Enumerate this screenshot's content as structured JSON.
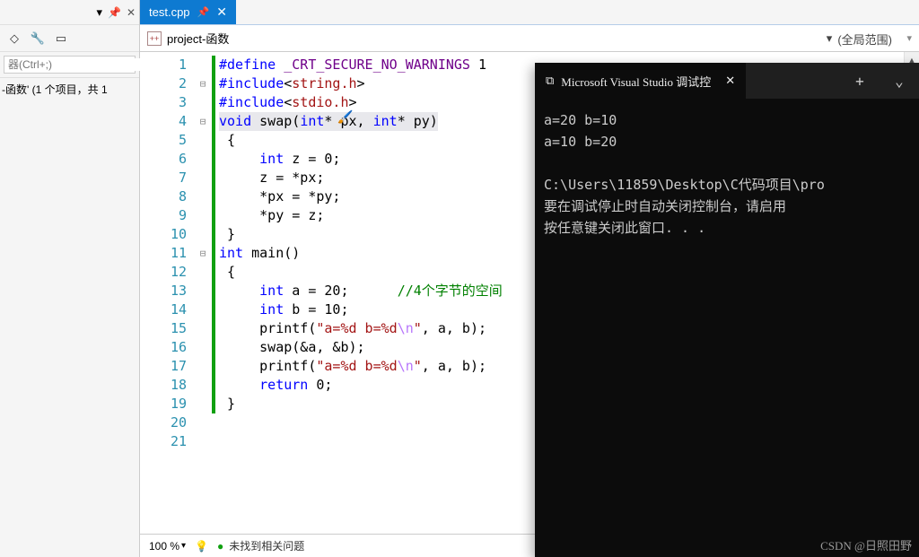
{
  "leftPanel": {
    "searchPlaceholder": "器(Ctrl+;)",
    "treeItem": "-函数' (1 个项目，共 1"
  },
  "tab": {
    "name": "test.cpp"
  },
  "breadcrumb": {
    "text": "project-函数"
  },
  "scope": {
    "text": "(全局范围)"
  },
  "code": {
    "lines": [
      {
        "n": 1,
        "fold": "",
        "html": "<span class='kw'>#define</span> <span class='macro'>_CRT_SECURE_NO_WARNINGS</span> 1"
      },
      {
        "n": 2,
        "fold": "⊟",
        "html": "<span class='kw'>#include</span>&lt;<span class='str'>string.h</span>&gt;"
      },
      {
        "n": 3,
        "fold": "",
        "html": "<span class='kw'>#include</span>&lt;<span class='str'>stdio.h</span>&gt;"
      },
      {
        "n": 4,
        "fold": "⊟",
        "html": "<span class='hl-line'><span class='kw'>void</span> swap(<span class='kw-int'>int</span><span class='star'>*</span> px, <span class='kw-int'>int</span><span class='star'>*</span> py)</span>"
      },
      {
        "n": 5,
        "fold": "",
        "html": " {"
      },
      {
        "n": 6,
        "fold": "",
        "html": "     <span class='kw-int'>int</span> z = 0;"
      },
      {
        "n": 7,
        "fold": "",
        "html": "     z = *px;"
      },
      {
        "n": 8,
        "fold": "",
        "html": "     *px = *py;"
      },
      {
        "n": 9,
        "fold": "",
        "html": "     *py = z;"
      },
      {
        "n": 10,
        "fold": "",
        "html": " }"
      },
      {
        "n": 11,
        "fold": "⊟",
        "html": "<span class='kw-int'>int</span> main()"
      },
      {
        "n": 12,
        "fold": "",
        "html": " {"
      },
      {
        "n": 13,
        "fold": "",
        "html": "     <span class='kw-int'>int</span> a = 20;      <span class='cmt'>//4个字节的空间</span>"
      },
      {
        "n": 14,
        "fold": "",
        "html": "     <span class='kw-int'>int</span> b = 10;"
      },
      {
        "n": 15,
        "fold": "",
        "html": "     printf(<span class='str'>\"a=%d b=%d<span class='esc'>\\n</span>\"</span>, a, b);"
      },
      {
        "n": 16,
        "fold": "",
        "html": "     swap(&a, &b);"
      },
      {
        "n": 17,
        "fold": "",
        "html": "     printf(<span class='str'>\"a=%d b=%d<span class='esc'>\\n</span>\"</span>, a, b);"
      },
      {
        "n": 18,
        "fold": "",
        "html": "     <span class='kw'>return</span> 0;"
      },
      {
        "n": 19,
        "fold": "",
        "html": " }"
      },
      {
        "n": 20,
        "fold": "",
        "html": ""
      },
      {
        "n": 21,
        "fold": "",
        "html": ""
      }
    ]
  },
  "statusBar": {
    "zoom": "100 %",
    "issues": "未找到相关问题"
  },
  "terminal": {
    "title": "Microsoft Visual Studio 调试控",
    "output": "a=20 b=10\na=10 b=20\n\nC:\\Users\\11859\\Desktop\\C代码项目\\pro\n要在调试停止时自动关闭控制台，请启用\n按任意键关闭此窗口. . ."
  },
  "watermark": "CSDN @日照田野"
}
